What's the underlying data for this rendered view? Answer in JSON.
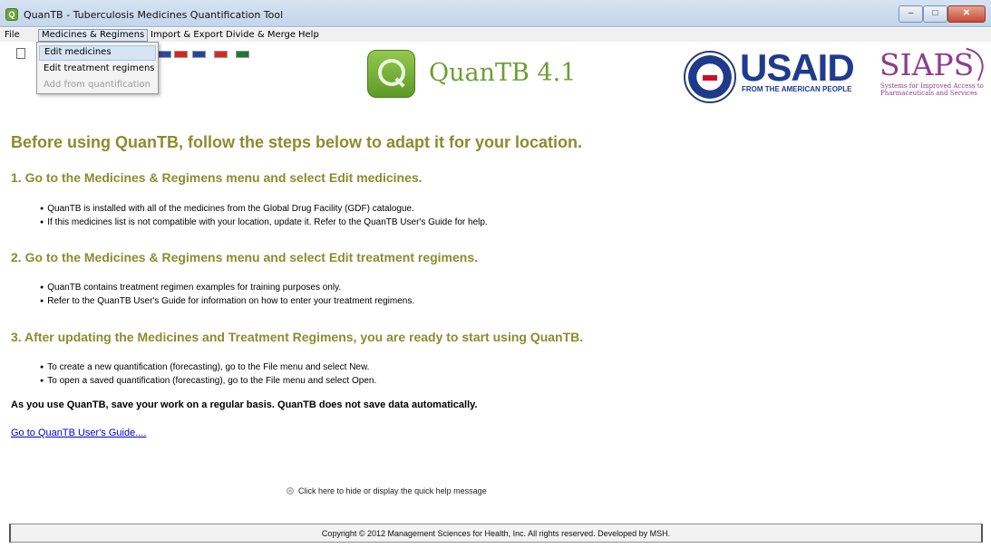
{
  "window": {
    "title": "QuanTB - Tuberculosis Medicines Quantification Tool",
    "minimize_glyph": "–",
    "maximize_glyph": "□",
    "close_glyph": "✕"
  },
  "menubar": {
    "items": [
      "File",
      "Medicines & Regimens",
      "Import & Export",
      "Divide & Merge",
      "Help"
    ]
  },
  "dropdown": {
    "items": [
      "Edit medicines",
      "Edit treatment regimens",
      "Add from quantification"
    ]
  },
  "toolbar": {
    "flags": [
      {
        "name": "flag-icon-uk",
        "color": "#2b4ba5"
      },
      {
        "name": "flag-icon-china",
        "color": "#d8241a"
      },
      {
        "name": "flag-icon-france",
        "color": "#1e48a0"
      },
      {
        "name": "flag-icon-spain",
        "color": "#d52b1e"
      },
      {
        "name": "flag-icon-portugal",
        "color": "#1f7a31"
      }
    ]
  },
  "branding": {
    "app_name": "QuanTB 4.1",
    "usaid_word": "USAID",
    "usaid_tagline": "FROM THE AMERICAN PEOPLE",
    "siaps_word": "SIAPS",
    "siaps_tagline": "Systems for Improved Access to Pharmaceuticals and Services"
  },
  "content": {
    "main_heading": "Before using QuanTB, follow the steps below to adapt it for your location.",
    "steps": [
      {
        "heading": "1. Go to the Medicines & Regimens menu and select Edit medicines.",
        "bullets": [
          "QuanTB is installed with all of the medicines from the Global Drug Facility (GDF) catalogue.",
          "If this medicines list is not compatible with your location, update it. Refer to the QuanTB User's Guide for help."
        ]
      },
      {
        "heading": "2. Go to the Medicines & Regimens menu and select Edit treatment regimens.",
        "bullets": [
          "QuanTB contains treatment regimen examples for training purposes only.",
          "Refer to the QuanTB User's Guide for information on how to enter your treatment regimens."
        ]
      },
      {
        "heading": "3. After updating the Medicines and Treatment Regimens, you are ready to start using QuanTB.",
        "bullets": [
          "To create a new quantification (forecasting), go to the File menu and select New.",
          "To open a saved quantification (forecasting), go to the File menu and select Open."
        ]
      }
    ],
    "save_note": "As you use QuanTB, save your work on a regular basis. QuanTB does not save data automatically.",
    "guide_link": "Go to QuanTB User's Guide....",
    "quick_help": "Click here to hide or display the quick help message"
  },
  "footer": {
    "copyright": "Copyright © 2012 Management Sciences for Health, Inc. All rights reserved. Developed by MSH."
  }
}
